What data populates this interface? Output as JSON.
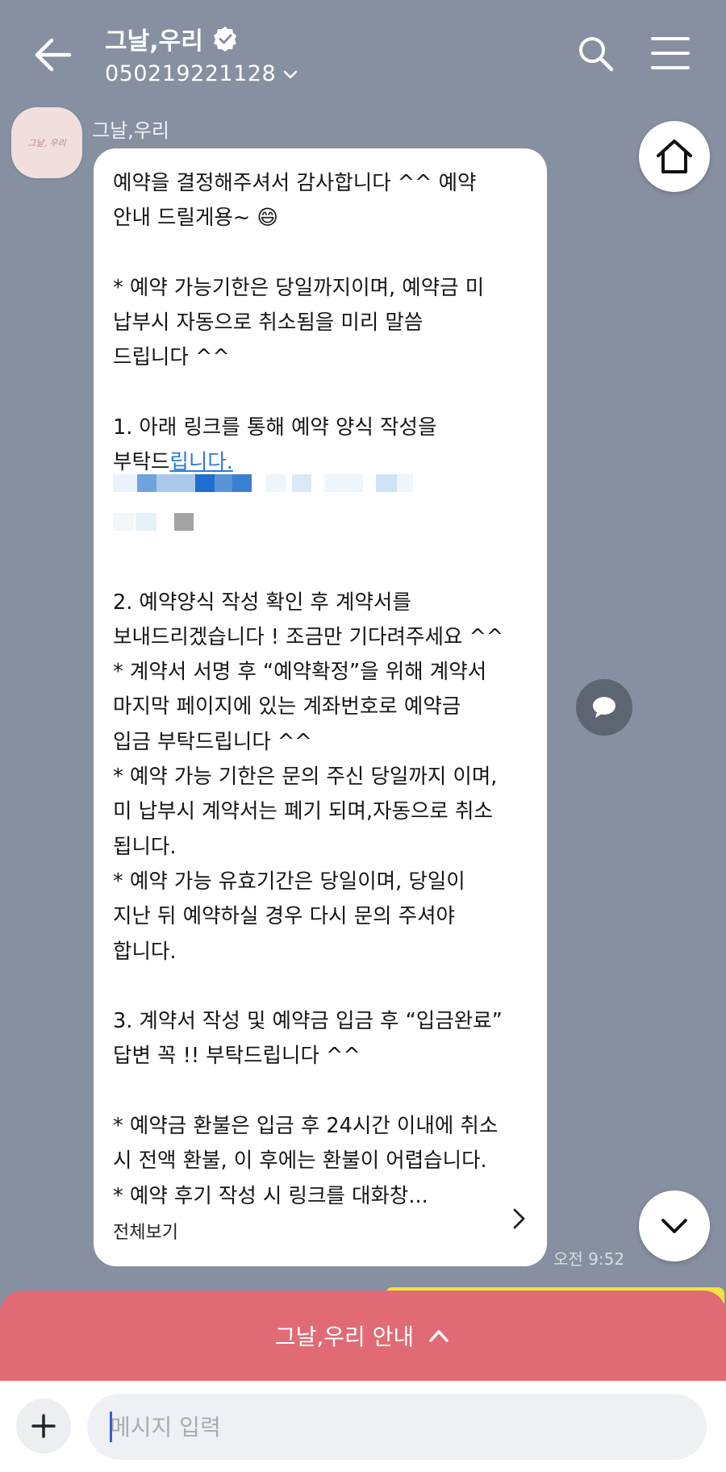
{
  "header": {
    "title": "그날,우리",
    "phone": "050219221128",
    "back_icon": "arrow-left-icon",
    "verified_icon": "verified-badge-icon",
    "search_icon": "search-icon",
    "menu_icon": "hamburger-menu-icon"
  },
  "message": {
    "sender": "그날,우리",
    "avatar_text": "그날, 우리",
    "body_1": "예약을 결정해주셔서 감사합니다 ^^ 예약\n안내 드릴게용~ 😄\n\n* 예약 가능기한은 당일까지이며, 예약금 미\n납부시 자동으로 취소됨을 미리 말씀\n드립니다 ^^\n\n1. 아래 링크를 통해 예약 양식 작성을\n부탁드",
    "link_text": "립니다.",
    "body_2": "\n\n\n\n2. 예약양식 작성 확인 후 계약서를\n보내드리겠습니다 ! 조금만 기다려주세요 ^^\n* 계약서 서명 후 “예약확정”을 위해 계약서\n마지막 페이지에 있는 계좌번호로 예약금\n입금 부탁드립니다 ^^\n* 예약 가능 기한은 문의 주신 당일까지 이며,\n미 납부시 계약서는 폐기 되며,자동으로 취소\n됩니다.\n* 예약 가능 유효기간은 당일이며, 당일이\n지난 뒤 예약하실 경우 다시 문의 주셔야\n합니다.\n\n3. 계약서 작성 및 예약금 입금 후 “입금완료”\n답변 꼭 !! 부탁드립니다 ^^\n\n* 예약금 환불은 입금 후 24시간 이내에 취소\n시 전액 환불, 이 후에는 환불이 어렵습니다.\n* 예약 후기 작성 시 링크를 대화창...",
    "view_all": "전체보기",
    "time": "오전 9:52"
  },
  "floating": {
    "home_icon": "home-icon",
    "chat_icon": "speech-bubble-icon",
    "scroll_down_icon": "chevron-down-icon"
  },
  "banner": {
    "label": "그날,우리 안내"
  },
  "input": {
    "placeholder": "메시지 입력",
    "plus_icon": "plus-icon"
  },
  "colors": {
    "background": "#8790a0",
    "banner": "#e06b75",
    "link": "#2d7ad6",
    "yellow_bubble": "#f7e23a"
  }
}
